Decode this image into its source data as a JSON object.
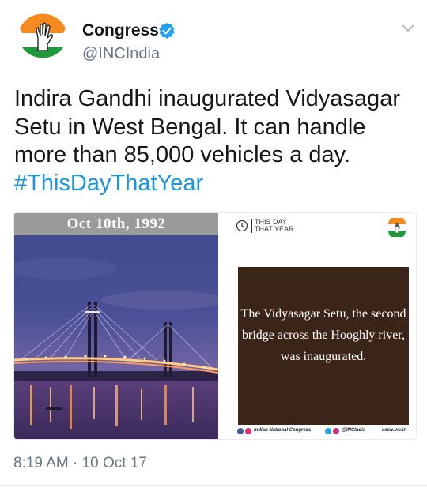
{
  "header": {
    "display_name": "Congress",
    "handle": "@INCIndia",
    "avatar_icon": "congress-hand-logo",
    "verified_icon": "verified-badge-icon",
    "menu_icon": "chevron-down-icon"
  },
  "tweet": {
    "text": "Indira Gandhi inaugurated Vidyasagar Setu in West Bengal. It can handle more than 85,000 vehicles a day.",
    "hashtag": "#ThisDayThatYear",
    "timestamp": "8:19 AM · 10 Oct 17"
  },
  "media": {
    "date_label": "Oct 10th, 1992",
    "badge_line1": "THIS DAY",
    "badge_line2": "THAT YEAR",
    "caption": "The Vidyasagar Setu, the second bridge across the Hooghly river, was inaugurated.",
    "footer_org": "Indian National Congress",
    "footer_handle": "@INCIndia",
    "footer_url": "www.inc.in"
  },
  "colors": {
    "hashtag": "#1b95e0",
    "secondary_text": "#657786",
    "verified": "#1da1f2",
    "caption_bg": "#3b2418"
  }
}
